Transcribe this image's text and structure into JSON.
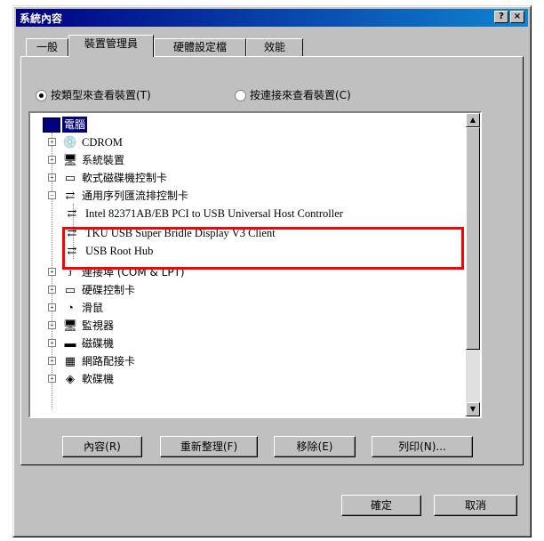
{
  "window": {
    "title": "系統內容",
    "help_label": "?",
    "close_label": "×"
  },
  "tabs": [
    {
      "label": "一般"
    },
    {
      "label": "裝置管理員"
    },
    {
      "label": "硬體設定檔"
    },
    {
      "label": "效能"
    }
  ],
  "view_options": {
    "by_type": "按類型來查看裝置(T)",
    "by_connection": "按連接來查看裝置(C)",
    "selected": "by_type"
  },
  "tree": {
    "root": "電腦",
    "items": [
      {
        "label": "CDROM",
        "expander": "+",
        "icon": "cdrom-icon",
        "glyph": "💿"
      },
      {
        "label": "系統裝置",
        "expander": "+",
        "icon": "monitor-icon",
        "glyph": "🖥"
      },
      {
        "label": "軟式磁碟機控制卡",
        "expander": "+",
        "icon": "drive-icon",
        "glyph": "▭"
      },
      {
        "label": "通用序列匯流排控制卡",
        "expander": "−",
        "icon": "usb-icon",
        "glyph": "⇄"
      },
      {
        "label": "Intel 82371AB/EB PCI to USB Universal Host Controller",
        "child": true,
        "icon": "usb-icon",
        "glyph": "⇄"
      },
      {
        "label": "TKU USB Super Bridle Display V3 Client",
        "child": true,
        "icon": "usb-icon",
        "glyph": "⇄"
      },
      {
        "label": "USB Root Hub",
        "child": true,
        "icon": "usb-icon",
        "glyph": "⇄"
      },
      {
        "label": "連接埠 (COM & LPT)",
        "expander": "+",
        "icon": "port-icon",
        "glyph": "ᴊ"
      },
      {
        "label": "硬碟控制卡",
        "expander": "+",
        "icon": "drive-icon",
        "glyph": "▭"
      },
      {
        "label": "滑鼠",
        "expander": "+",
        "icon": "mouse-icon",
        "glyph": "◔"
      },
      {
        "label": "監視器",
        "expander": "+",
        "icon": "monitor-icon",
        "glyph": "🖥"
      },
      {
        "label": "磁碟機",
        "expander": "+",
        "icon": "disk-icon",
        "glyph": "▬"
      },
      {
        "label": "網路配接卡",
        "expander": "+",
        "icon": "network-icon",
        "glyph": "▦"
      },
      {
        "label": "軟碟機",
        "expander": "+",
        "icon": "floppy-icon",
        "glyph": "◈"
      }
    ]
  },
  "actions": {
    "properties": "內容(R)",
    "refresh": "重新整理(F)",
    "remove": "移除(E)",
    "print": "列印(N)..."
  },
  "footer": {
    "ok": "確定",
    "cancel": "取消"
  },
  "colors": {
    "titlebar": "#000080",
    "highlight_box": "#ff0000",
    "face": "#c0c0c0"
  }
}
